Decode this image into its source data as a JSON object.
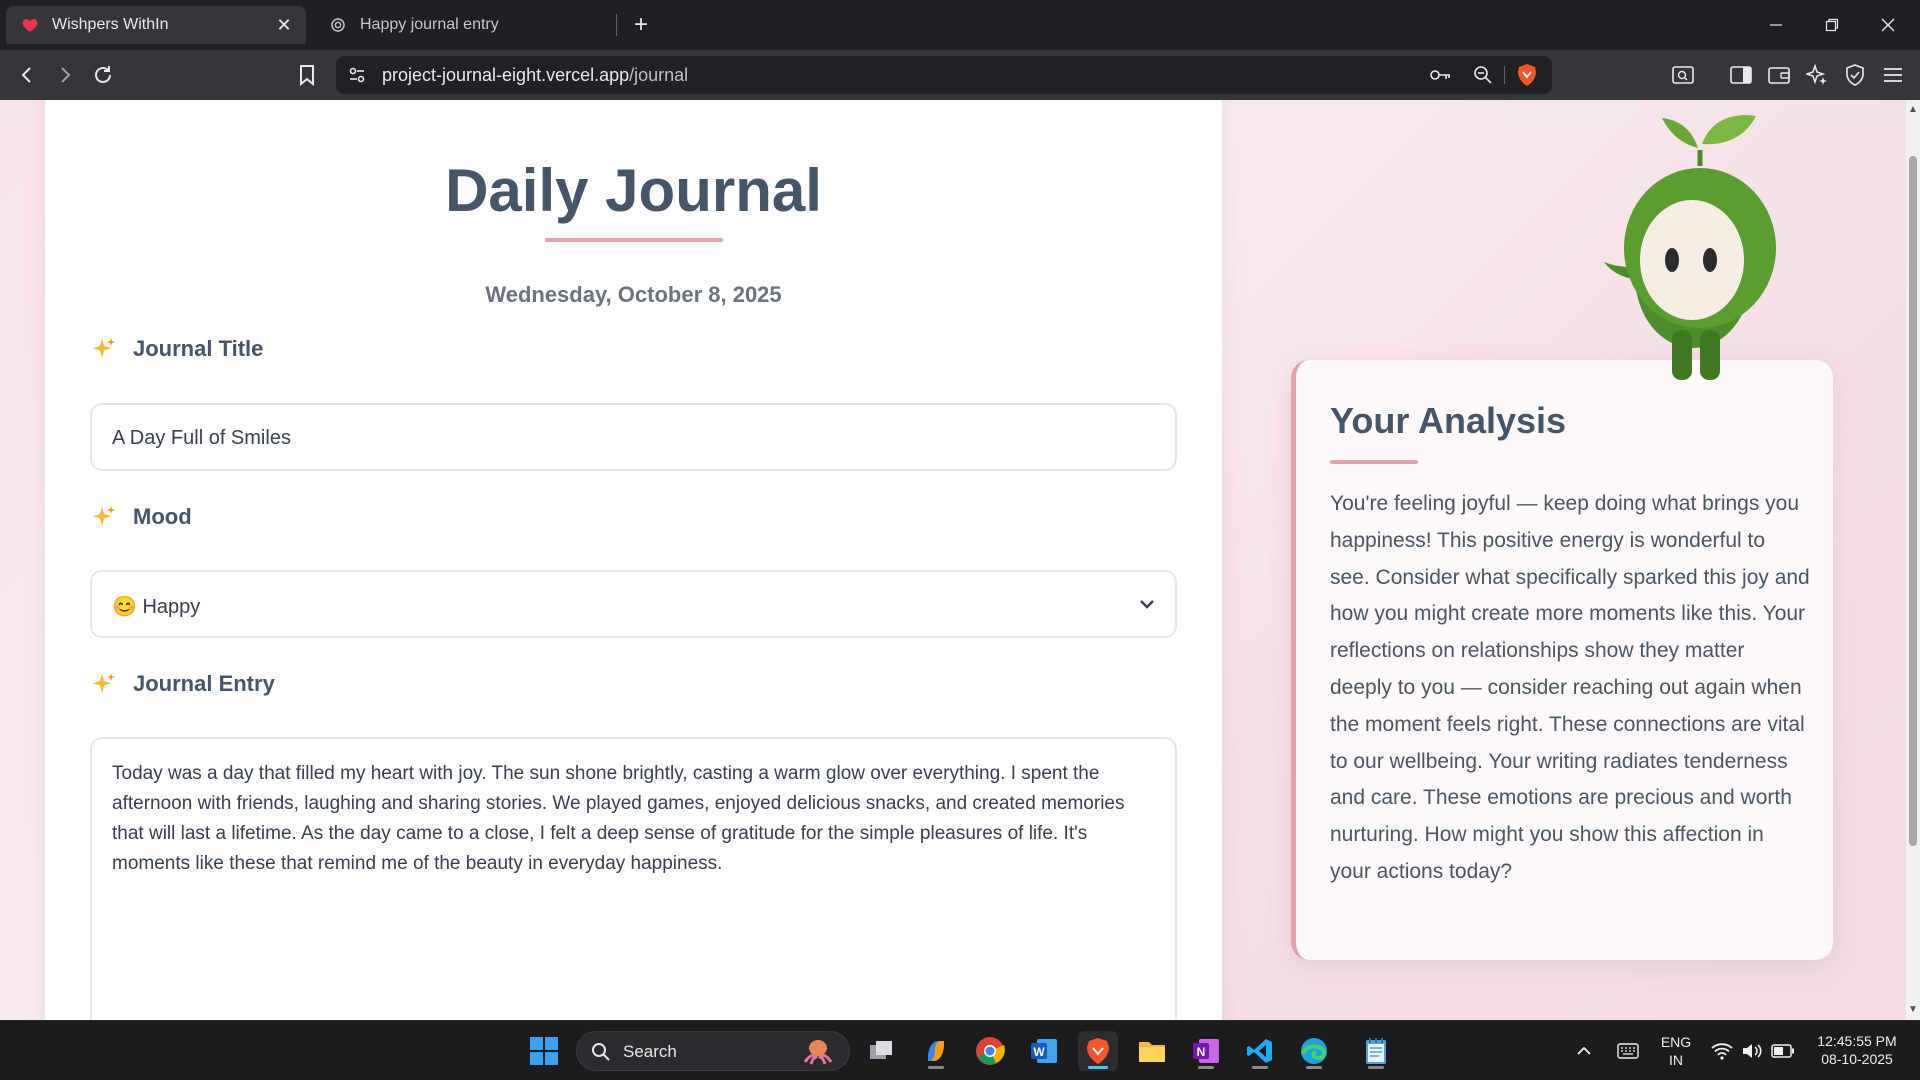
{
  "browser": {
    "tabs": [
      {
        "title": "Wishpers WithIn",
        "active": true
      },
      {
        "title": "Happy journal entry",
        "active": false
      }
    ],
    "url_host": "project-journal-eight.vercel.app",
    "url_path": "/journal"
  },
  "page": {
    "title": "Daily Journal",
    "date": "Wednesday, October 8, 2025",
    "fields": {
      "title_label": "Journal Title",
      "title_value": "A Day Full of Smiles",
      "mood_label": "Mood",
      "mood_emoji": "😊",
      "mood_value": "Happy",
      "entry_label": "Journal Entry",
      "entry_value": "Today was a day that filled my heart with joy. The sun shone brightly, casting a warm glow over everything. I spent the afternoon with friends, laughing and sharing stories. We played games, enjoyed delicious snacks, and created memories that will last a lifetime. As the day came to a close, I felt a deep sense of gratitude for the simple pleasures of life. It's moments like these that remind me of the beauty in everyday happiness."
    },
    "analysis": {
      "title": "Your Analysis",
      "body": "You're feeling joyful — keep doing what brings you happiness! This positive energy is wonderful to see. Consider what specifically sparked this joy and how you might create more moments like this. Your reflections on relationships show they matter deeply to you — consider reaching out again when the moment feels right. These connections are vital to our wellbeing. Your writing radiates tenderness and care. These emotions are precious and worth nurturing. How might you show this affection in your actions today?"
    }
  },
  "taskbar": {
    "search_label": "Search",
    "language_line1": "ENG",
    "language_line2": "IN",
    "time": "12:45:55 PM",
    "date": "08-10-2025"
  },
  "colors": {
    "accent_pink": "#e0a3ad",
    "heading": "#475569",
    "page_bg": "#f6e4e8"
  }
}
